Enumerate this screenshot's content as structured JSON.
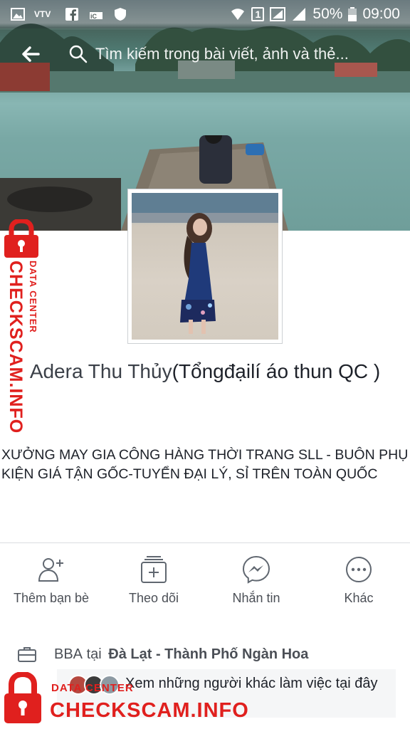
{
  "status_bar": {
    "battery": "50%",
    "time": "09:00",
    "sim_badge": "1",
    "left_icons": [
      "gallery-icon",
      "vtv-icon",
      "facebook-icon",
      "lock-app-icon",
      "shield-icon"
    ],
    "right_icons": [
      "wifi-icon",
      "sim-icon",
      "signal-icon",
      "battery-icon"
    ]
  },
  "search": {
    "placeholder": "Tìm kiếm trong bài viết, ảnh và thẻ..."
  },
  "profile": {
    "name": "Adera Thu Thủy",
    "name_extra": "(Tổngđạilí áo thun QC )",
    "bio": "XƯỞNG MAY GIA CÔNG HÀNG THỜI TRANG SLL - BUÔN PHỤ KIỆN GIÁ TẬN GỐC-TUYỂN ĐẠI LÝ, SỈ TRÊN TOÀN QUỐC"
  },
  "actions": [
    {
      "label": "Thêm bạn bè",
      "icon": "add-friend-icon"
    },
    {
      "label": "Theo dõi",
      "icon": "follow-icon"
    },
    {
      "label": "Nhắn tin",
      "icon": "messenger-icon"
    },
    {
      "label": "Khác",
      "icon": "more-icon"
    }
  ],
  "work": {
    "company": "BBA",
    "at": "tại",
    "place": "Đà Lạt - Thành Phố Ngàn Hoa"
  },
  "coworkers": {
    "text": "Xem những người khác làm việc tại đây"
  },
  "watermark": {
    "brand": "CHECKSCAM.INFO",
    "sub": "DATA CENTER"
  },
  "colors": {
    "watermark_red": "#e0201e",
    "text": "#1d2129",
    "secondary_text": "#4b4f56",
    "divider": "#dadde1"
  }
}
